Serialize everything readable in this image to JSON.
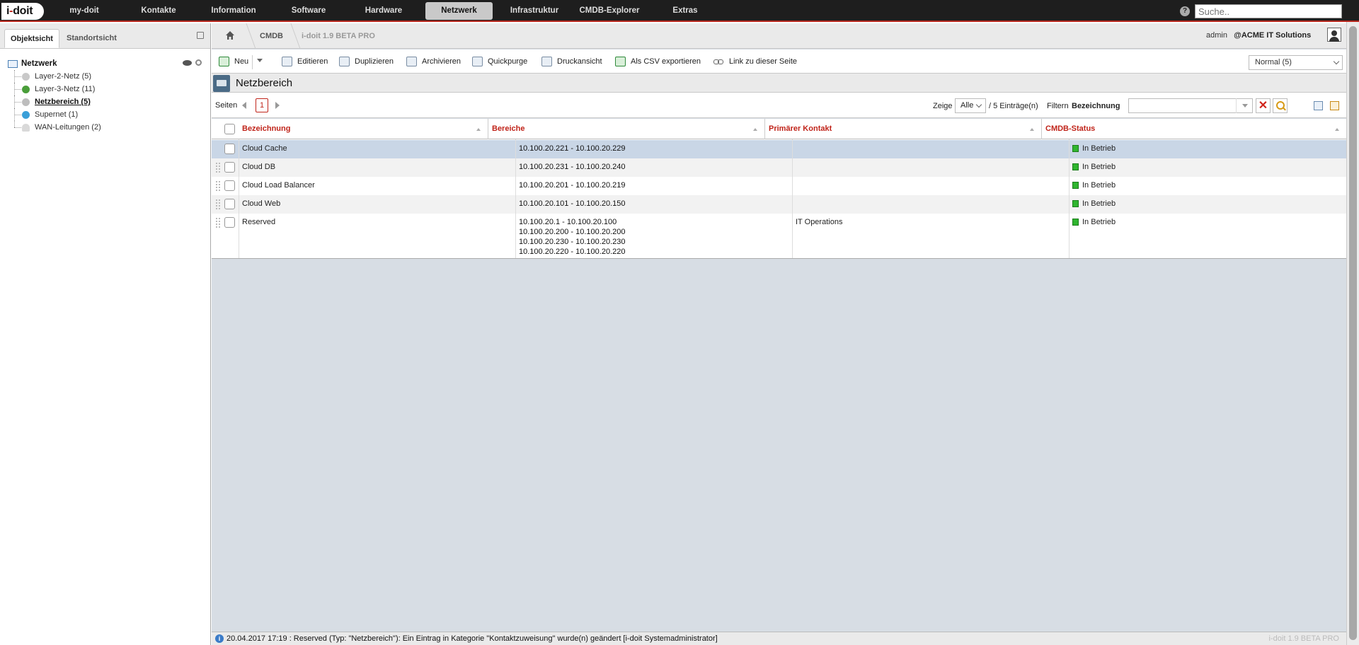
{
  "logo": {
    "text_i": "i",
    "text_dash": "-",
    "text_doit": "doit"
  },
  "topnav": {
    "items": [
      "my-doit",
      "Kontakte",
      "Information",
      "Software",
      "Hardware",
      "Netzwerk",
      "Infrastruktur",
      "CMDB-Explorer",
      "Extras"
    ],
    "active": "Netzwerk",
    "search_placeholder": "Suche.."
  },
  "lefttabs": {
    "objekt": "Objektsicht",
    "standort": "Standortsicht"
  },
  "tree": {
    "root": "Netzwerk",
    "items": [
      {
        "label": "Layer-2-Netz (5)",
        "color": "#c9c9c9"
      },
      {
        "label": "Layer-3-Netz (11)",
        "color": "#4a9e3a"
      },
      {
        "label": "Netzbereich (5)",
        "color": "#bdbdbd"
      },
      {
        "label": "Supernet (1)",
        "color": "#3a9fd8"
      },
      {
        "label": "WAN-Leitungen (2)",
        "color": "#d9d9d9"
      }
    ],
    "selected": "Netzbereich (5)"
  },
  "breadcrumb": {
    "cmdb": "CMDB",
    "version": "i-doit 1.9 BETA PRO"
  },
  "user": {
    "name": "admin",
    "tenant": "@ACME IT Solutions"
  },
  "toolbar": {
    "new": "Neu",
    "edit": "Editieren",
    "duplicate": "Duplizieren",
    "archive": "Archivieren",
    "quickpurge": "Quickpurge",
    "print": "Druckansicht",
    "csv": "Als CSV exportieren",
    "link": "Link zu dieser Seite",
    "view_select": "Normal (5)"
  },
  "page_title": "Netzbereich",
  "listbar": {
    "pages_label": "Seiten",
    "current_page": "1",
    "show_label": "Zeige",
    "show_value": "Alle",
    "entries_label": "/ 5 Einträge(n)",
    "filter_label": "Filtern",
    "filter_field": "Bezeichnung"
  },
  "table": {
    "headers": [
      "Bezeichnung",
      "Bereiche",
      "Primärer Kontakt",
      "CMDB-Status"
    ],
    "rows": [
      {
        "name": "Cloud Cache",
        "ranges": "10.100.20.221 - 10.100.20.229",
        "contact": "",
        "status": "In Betrieb"
      },
      {
        "name": "Cloud DB",
        "ranges": "10.100.20.231 - 10.100.20.240",
        "contact": "",
        "status": "In Betrieb"
      },
      {
        "name": "Cloud Load Balancer",
        "ranges": "10.100.20.201 - 10.100.20.219",
        "contact": "",
        "status": "In Betrieb"
      },
      {
        "name": "Cloud Web",
        "ranges": "10.100.20.101 - 10.100.20.150",
        "contact": "",
        "status": "In Betrieb"
      },
      {
        "name": "Reserved",
        "ranges_multi": [
          "10.100.20.1 - 10.100.20.100",
          "10.100.20.200 - 10.100.20.200",
          "10.100.20.230 - 10.100.20.230",
          "10.100.20.220 - 10.100.20.220"
        ],
        "contact": "IT Operations",
        "status": "In Betrieb"
      }
    ]
  },
  "statusbar": {
    "message": "20.04.2017 17:19 : Reserved (Typ: \"Netzbereich\"): Ein Eintrag in Kategorie \"Kontaktzuweisung\" wurde(n) geändert [i-doit Systemadministrator]",
    "version": "i-doit 1.9 BETA PRO"
  },
  "colors": {
    "accent": "#c0241a",
    "status_ok": "#2fb52f"
  }
}
